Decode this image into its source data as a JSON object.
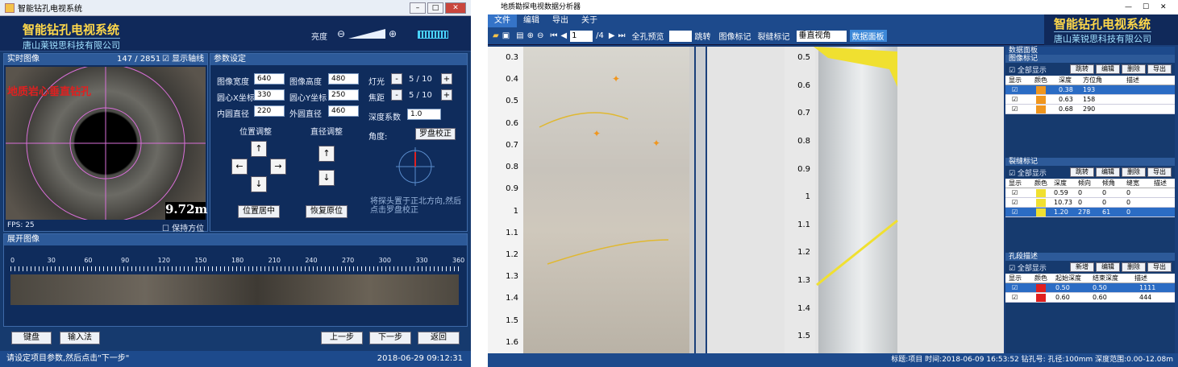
{
  "left": {
    "title": "智能钻孔电视系统",
    "brand_title": "智能钻孔电视系统",
    "brand_sub": "唐山莱锐思科技有限公司",
    "brightness_label": "亮度",
    "live": {
      "header": "实时图像",
      "counter": "147 / 2851",
      "show_axis": "显示轴线",
      "overlay": "地质岩心垂直钻孔",
      "depth": "9.72m",
      "fps": "FPS: 25",
      "keep_orient": "保持方位"
    },
    "params": {
      "header": "参数设定",
      "img_w_label": "图像宽度",
      "img_w": "640",
      "img_h_label": "图像高度",
      "img_h": "480",
      "cx_label": "圆心X坐标",
      "cx": "330",
      "cy_label": "圆心Y坐标",
      "cy": "250",
      "inner_label": "内圆直径",
      "inner": "220",
      "outer_label": "外圆直径",
      "outer": "460",
      "light_label": "灯光",
      "light": "5 / 10",
      "focus_label": "焦距",
      "focus": "5 / 10",
      "depth_coef_label": "深度系数",
      "depth_coef": "1.0",
      "angle_label": "角度:",
      "compass_btn": "罗盘校正",
      "pos_adj": "位置调整",
      "dia_adj": "直径调整",
      "center_btn": "位置居中",
      "restore_btn": "恢复原位",
      "hint": "将探头置于正北方向,然后点击罗盘校正"
    },
    "unroll": {
      "header": "展开图像",
      "ticks": [
        "0",
        "30",
        "60",
        "90",
        "120",
        "150",
        "180",
        "210",
        "240",
        "270",
        "300",
        "330",
        "360"
      ]
    },
    "buttons": {
      "keyboard": "键盘",
      "ime": "输入法",
      "prev": "上一步",
      "next": "下一步",
      "back": "返回"
    },
    "status": "请设定项目参数,然后点击\"下一步\"",
    "time": "2018-06-29 09:12:31"
  },
  "right": {
    "title": "地质勘探电视数据分析器",
    "brand_title": "智能钻孔电视系统",
    "brand_sub": "唐山莱锐思科技有限公司",
    "menu": [
      "文件",
      "编辑",
      "导出",
      "关于"
    ],
    "toolbar": {
      "page": "1",
      "pages": "/4",
      "full_preview": "全孔预览",
      "jump": "跳转",
      "img_mark": "图像标记",
      "crack_mark": "裂缝标记",
      "view": "垂直视角",
      "data_panel": "数据面板"
    },
    "ruler1": [
      "0.3",
      "0.4",
      "0.5",
      "0.6",
      "0.7",
      "0.8",
      "0.9",
      "1",
      "1.1",
      "1.2",
      "1.3",
      "1.4",
      "1.5",
      "1.6"
    ],
    "ruler2": [
      "0.5",
      "0.6",
      "0.7",
      "0.8",
      "0.9",
      "1",
      "1.1",
      "1.2",
      "1.3",
      "1.4",
      "1.5"
    ],
    "panel": {
      "title": "数据面板",
      "img_marks": {
        "header": "图像标记",
        "show_all": "全部显示",
        "btns": [
          "跳转",
          "编辑",
          "删除",
          "导出"
        ],
        "cols": [
          "显示",
          "颜色",
          "深度",
          "方位角",
          "描述"
        ],
        "rows": [
          {
            "depth": "0.38",
            "az": "193",
            "desc": "",
            "color": "#f0961e",
            "sel": true
          },
          {
            "depth": "0.63",
            "az": "158",
            "desc": "",
            "color": "#f0961e",
            "sel": false
          },
          {
            "depth": "0.68",
            "az": "290",
            "desc": "",
            "color": "#f0961e",
            "sel": false
          }
        ]
      },
      "crack_marks": {
        "header": "裂缝标记",
        "show_all": "全部显示",
        "btns": [
          "跳转",
          "编辑",
          "删除",
          "导出"
        ],
        "cols": [
          "显示",
          "颜色",
          "深度",
          "倾向",
          "倾角",
          "缝宽",
          "描述"
        ],
        "rows": [
          {
            "depth": "0.59",
            "dir": "0",
            "ang": "0",
            "w": "0",
            "color": "#f0e030",
            "sel": false
          },
          {
            "depth": "10.73",
            "dir": "0",
            "ang": "0",
            "w": "0",
            "color": "#f0e030",
            "sel": false
          },
          {
            "depth": "1.20",
            "dir": "278",
            "ang": "61",
            "w": "0",
            "color": "#f0e030",
            "sel": true
          }
        ]
      },
      "holes": {
        "header": "孔段描述",
        "show_all": "全部显示",
        "btns": [
          "新增",
          "编辑",
          "删除",
          "导出"
        ],
        "cols": [
          "显示",
          "颜色",
          "起始深度",
          "结束深度",
          "描述"
        ],
        "rows": [
          {
            "start": "0.50",
            "end": "0.50",
            "desc": "1111",
            "color": "#e02020",
            "sel": true
          },
          {
            "start": "0.60",
            "end": "0.60",
            "desc": "444",
            "color": "#e02020",
            "sel": false
          }
        ]
      }
    },
    "status": "标题:项目  时间:2018-06-09 16:53:52  钻孔号:  孔径:100mm  深度范围:0.00-12.08m"
  }
}
